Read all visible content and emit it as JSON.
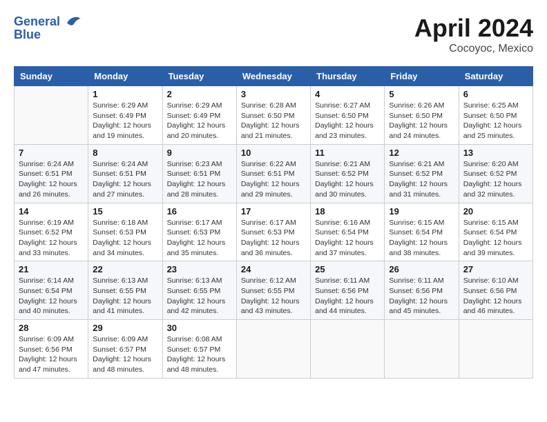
{
  "header": {
    "logo_line1": "General",
    "logo_line2": "Blue",
    "main_title": "April 2024",
    "subtitle": "Cocoyoc, Mexico"
  },
  "calendar": {
    "days_of_week": [
      "Sunday",
      "Monday",
      "Tuesday",
      "Wednesday",
      "Thursday",
      "Friday",
      "Saturday"
    ],
    "weeks": [
      [
        {
          "day": "",
          "sunrise": "",
          "sunset": "",
          "daylight": "",
          "empty": true
        },
        {
          "day": "1",
          "sunrise": "Sunrise: 6:29 AM",
          "sunset": "Sunset: 6:49 PM",
          "daylight": "Daylight: 12 hours and 19 minutes."
        },
        {
          "day": "2",
          "sunrise": "Sunrise: 6:29 AM",
          "sunset": "Sunset: 6:49 PM",
          "daylight": "Daylight: 12 hours and 20 minutes."
        },
        {
          "day": "3",
          "sunrise": "Sunrise: 6:28 AM",
          "sunset": "Sunset: 6:50 PM",
          "daylight": "Daylight: 12 hours and 21 minutes."
        },
        {
          "day": "4",
          "sunrise": "Sunrise: 6:27 AM",
          "sunset": "Sunset: 6:50 PM",
          "daylight": "Daylight: 12 hours and 23 minutes."
        },
        {
          "day": "5",
          "sunrise": "Sunrise: 6:26 AM",
          "sunset": "Sunset: 6:50 PM",
          "daylight": "Daylight: 12 hours and 24 minutes."
        },
        {
          "day": "6",
          "sunrise": "Sunrise: 6:25 AM",
          "sunset": "Sunset: 6:50 PM",
          "daylight": "Daylight: 12 hours and 25 minutes."
        }
      ],
      [
        {
          "day": "7",
          "sunrise": "Sunrise: 6:24 AM",
          "sunset": "Sunset: 6:51 PM",
          "daylight": "Daylight: 12 hours and 26 minutes."
        },
        {
          "day": "8",
          "sunrise": "Sunrise: 6:24 AM",
          "sunset": "Sunset: 6:51 PM",
          "daylight": "Daylight: 12 hours and 27 minutes."
        },
        {
          "day": "9",
          "sunrise": "Sunrise: 6:23 AM",
          "sunset": "Sunset: 6:51 PM",
          "daylight": "Daylight: 12 hours and 28 minutes."
        },
        {
          "day": "10",
          "sunrise": "Sunrise: 6:22 AM",
          "sunset": "Sunset: 6:51 PM",
          "daylight": "Daylight: 12 hours and 29 minutes."
        },
        {
          "day": "11",
          "sunrise": "Sunrise: 6:21 AM",
          "sunset": "Sunset: 6:52 PM",
          "daylight": "Daylight: 12 hours and 30 minutes."
        },
        {
          "day": "12",
          "sunrise": "Sunrise: 6:21 AM",
          "sunset": "Sunset: 6:52 PM",
          "daylight": "Daylight: 12 hours and 31 minutes."
        },
        {
          "day": "13",
          "sunrise": "Sunrise: 6:20 AM",
          "sunset": "Sunset: 6:52 PM",
          "daylight": "Daylight: 12 hours and 32 minutes."
        }
      ],
      [
        {
          "day": "14",
          "sunrise": "Sunrise: 6:19 AM",
          "sunset": "Sunset: 6:52 PM",
          "daylight": "Daylight: 12 hours and 33 minutes."
        },
        {
          "day": "15",
          "sunrise": "Sunrise: 6:18 AM",
          "sunset": "Sunset: 6:53 PM",
          "daylight": "Daylight: 12 hours and 34 minutes."
        },
        {
          "day": "16",
          "sunrise": "Sunrise: 6:17 AM",
          "sunset": "Sunset: 6:53 PM",
          "daylight": "Daylight: 12 hours and 35 minutes."
        },
        {
          "day": "17",
          "sunrise": "Sunrise: 6:17 AM",
          "sunset": "Sunset: 6:53 PM",
          "daylight": "Daylight: 12 hours and 36 minutes."
        },
        {
          "day": "18",
          "sunrise": "Sunrise: 6:16 AM",
          "sunset": "Sunset: 6:54 PM",
          "daylight": "Daylight: 12 hours and 37 minutes."
        },
        {
          "day": "19",
          "sunrise": "Sunrise: 6:15 AM",
          "sunset": "Sunset: 6:54 PM",
          "daylight": "Daylight: 12 hours and 38 minutes."
        },
        {
          "day": "20",
          "sunrise": "Sunrise: 6:15 AM",
          "sunset": "Sunset: 6:54 PM",
          "daylight": "Daylight: 12 hours and 39 minutes."
        }
      ],
      [
        {
          "day": "21",
          "sunrise": "Sunrise: 6:14 AM",
          "sunset": "Sunset: 6:54 PM",
          "daylight": "Daylight: 12 hours and 40 minutes."
        },
        {
          "day": "22",
          "sunrise": "Sunrise: 6:13 AM",
          "sunset": "Sunset: 6:55 PM",
          "daylight": "Daylight: 12 hours and 41 minutes."
        },
        {
          "day": "23",
          "sunrise": "Sunrise: 6:13 AM",
          "sunset": "Sunset: 6:55 PM",
          "daylight": "Daylight: 12 hours and 42 minutes."
        },
        {
          "day": "24",
          "sunrise": "Sunrise: 6:12 AM",
          "sunset": "Sunset: 6:55 PM",
          "daylight": "Daylight: 12 hours and 43 minutes."
        },
        {
          "day": "25",
          "sunrise": "Sunrise: 6:11 AM",
          "sunset": "Sunset: 6:56 PM",
          "daylight": "Daylight: 12 hours and 44 minutes."
        },
        {
          "day": "26",
          "sunrise": "Sunrise: 6:11 AM",
          "sunset": "Sunset: 6:56 PM",
          "daylight": "Daylight: 12 hours and 45 minutes."
        },
        {
          "day": "27",
          "sunrise": "Sunrise: 6:10 AM",
          "sunset": "Sunset: 6:56 PM",
          "daylight": "Daylight: 12 hours and 46 minutes."
        }
      ],
      [
        {
          "day": "28",
          "sunrise": "Sunrise: 6:09 AM",
          "sunset": "Sunset: 6:56 PM",
          "daylight": "Daylight: 12 hours and 47 minutes."
        },
        {
          "day": "29",
          "sunrise": "Sunrise: 6:09 AM",
          "sunset": "Sunset: 6:57 PM",
          "daylight": "Daylight: 12 hours and 48 minutes."
        },
        {
          "day": "30",
          "sunrise": "Sunrise: 6:08 AM",
          "sunset": "Sunset: 6:57 PM",
          "daylight": "Daylight: 12 hours and 48 minutes."
        },
        {
          "day": "",
          "sunrise": "",
          "sunset": "",
          "daylight": "",
          "empty": true
        },
        {
          "day": "",
          "sunrise": "",
          "sunset": "",
          "daylight": "",
          "empty": true
        },
        {
          "day": "",
          "sunrise": "",
          "sunset": "",
          "daylight": "",
          "empty": true
        },
        {
          "day": "",
          "sunrise": "",
          "sunset": "",
          "daylight": "",
          "empty": true
        }
      ]
    ]
  }
}
